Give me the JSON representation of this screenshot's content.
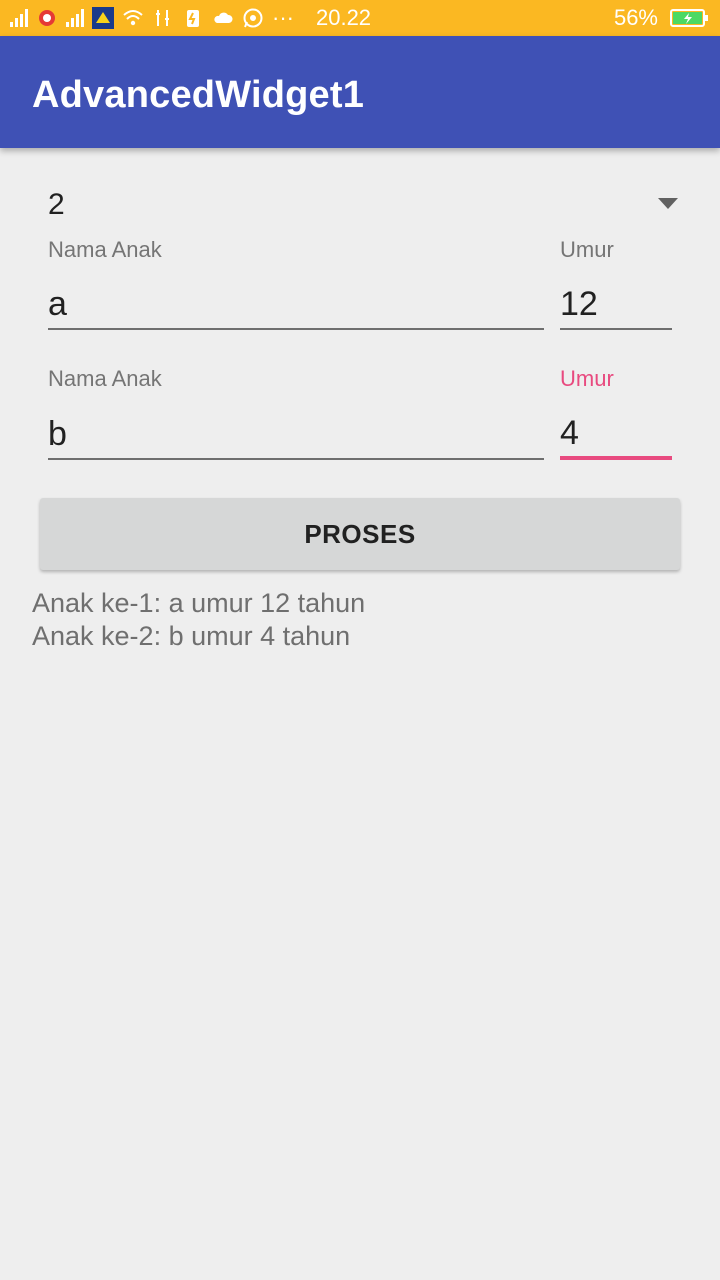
{
  "status_bar": {
    "time": "20.22",
    "battery": "56%",
    "accent_color": "#fbb822"
  },
  "app_bar": {
    "title": "AdvancedWidget1",
    "color": "#3f51b5"
  },
  "spinner": {
    "selected_value": "2"
  },
  "children": [
    {
      "name_label": "Nama Anak",
      "name_value": "a",
      "age_label": "Umur",
      "age_value": "12"
    },
    {
      "name_label": "Nama Anak",
      "name_value": "b",
      "age_label": "Umur",
      "age_value": "4"
    }
  ],
  "focus_color": "#e84a7f",
  "button": {
    "label": "PROSES"
  },
  "results": [
    "Anak ke-1: a umur 12 tahun",
    "Anak ke-2: b umur 4 tahun"
  ]
}
